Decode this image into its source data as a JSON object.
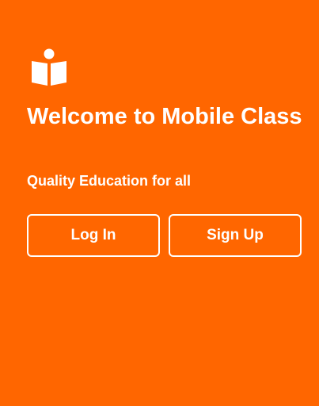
{
  "app": {
    "logo_icon": "book-reader-icon",
    "title": "Welcome to Mobile Class",
    "subtitle": "Quality Education for all"
  },
  "actions": {
    "login_label": "Log In",
    "signup_label": "Sign Up"
  },
  "colors": {
    "background": "#FF6600",
    "foreground": "#FFFFFF"
  }
}
